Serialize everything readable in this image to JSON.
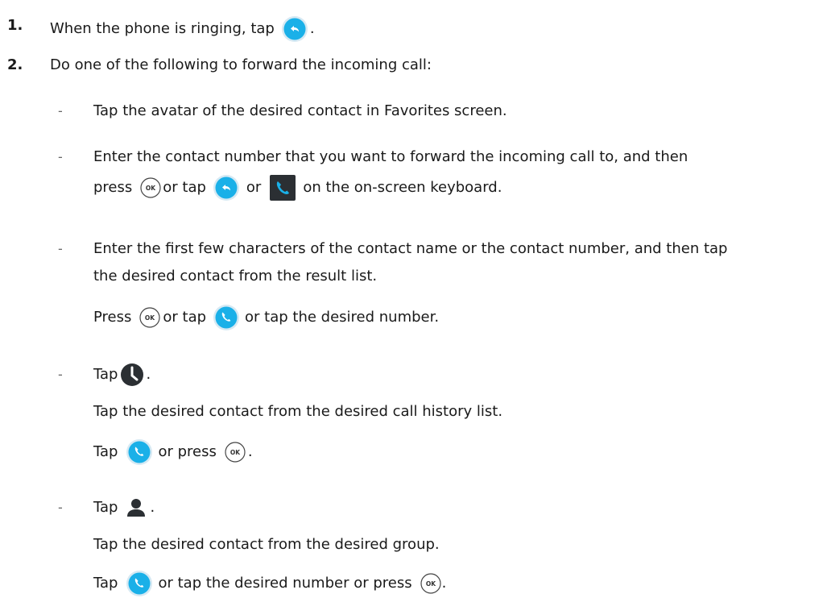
{
  "step1": {
    "number": "1.",
    "before": "When the phone is ringing, tap",
    "after": "."
  },
  "step2": {
    "number": "2.",
    "text": "Do one of the following to forward the incoming call:"
  },
  "options": {
    "dash": "-",
    "favorites": "Tap the avatar of the desired contact in Favorites screen.",
    "enter_number": {
      "line1": "Enter the contact number that you want to forward the incoming call to, and then",
      "press": "press",
      "or_tap": "or tap",
      "or": "or",
      "on_keyboard": "on the on-screen keyboard."
    },
    "search": {
      "line1": "Enter the first few characters of the contact name or the contact number, and then tap",
      "line2": "the desired contact from the result list.",
      "press": "Press",
      "or_tap": "or tap",
      "or_tap_number": "or tap the desired number."
    },
    "history": {
      "tap": "Tap",
      "period": ".",
      "line2": "Tap the desired contact from the desired call history list.",
      "tap2": "Tap",
      "or_press": "or press",
      "period2": "."
    },
    "directory": {
      "tap": "Tap",
      "period": ".",
      "line2": "Tap the desired contact from the desired group.",
      "tap2": "Tap",
      "or_tap_number_press": "or tap the desired number or press",
      "period2": "."
    }
  },
  "icons": {
    "ok_key_label": "OK",
    "blue": "#1ab0e8",
    "dark": "#2b2f33"
  }
}
